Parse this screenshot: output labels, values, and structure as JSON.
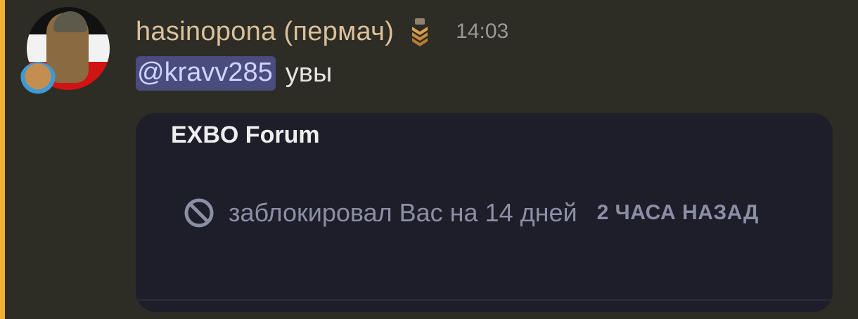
{
  "message": {
    "author": "hasinopona (пермач)",
    "timestamp": "14:03",
    "mention": "@kravv285",
    "text": "увы"
  },
  "embed": {
    "title": "EXBO Forum",
    "ban_text": "заблокировал Вас на 14 дней",
    "time_ago": "2 ЧАСА НАЗАД"
  },
  "icons": {
    "avatar": "user-avatar",
    "avatar_decoration": "capybara-decoration-icon",
    "rank": "rank-chevron-icon",
    "ban": "ban-icon"
  },
  "colors": {
    "background": "#2d2c25",
    "mention_bar": "#f0b132",
    "username": "#dbc09a",
    "mention_bg": "#4a4c7e",
    "embed_bg": "#1e1e2b"
  }
}
